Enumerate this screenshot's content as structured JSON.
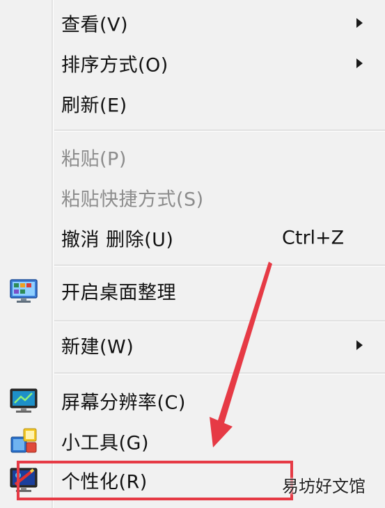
{
  "menu": {
    "items": [
      {
        "label": "查看(V)"
      },
      {
        "label": "排序方式(O)"
      },
      {
        "label": "刷新(E)"
      },
      {
        "label": "粘贴(P)"
      },
      {
        "label": "粘贴快捷方式(S)"
      },
      {
        "label": "撤消 删除(U)",
        "shortcut": "Ctrl+Z"
      },
      {
        "label": "开启桌面整理"
      },
      {
        "label": "新建(W)"
      },
      {
        "label": "屏幕分辨率(C)"
      },
      {
        "label": "小工具(G)"
      },
      {
        "label": "个性化(R)"
      }
    ]
  },
  "watermark": "易坊好文馆",
  "colors": {
    "menu_background": "#f1f1f1",
    "disabled_text": "#8c8c8c",
    "annotation_red": "#e63a45"
  },
  "icons": [
    "desktop-organize-icon",
    "screen-resolution-icon",
    "gadgets-icon",
    "personalize-icon"
  ]
}
